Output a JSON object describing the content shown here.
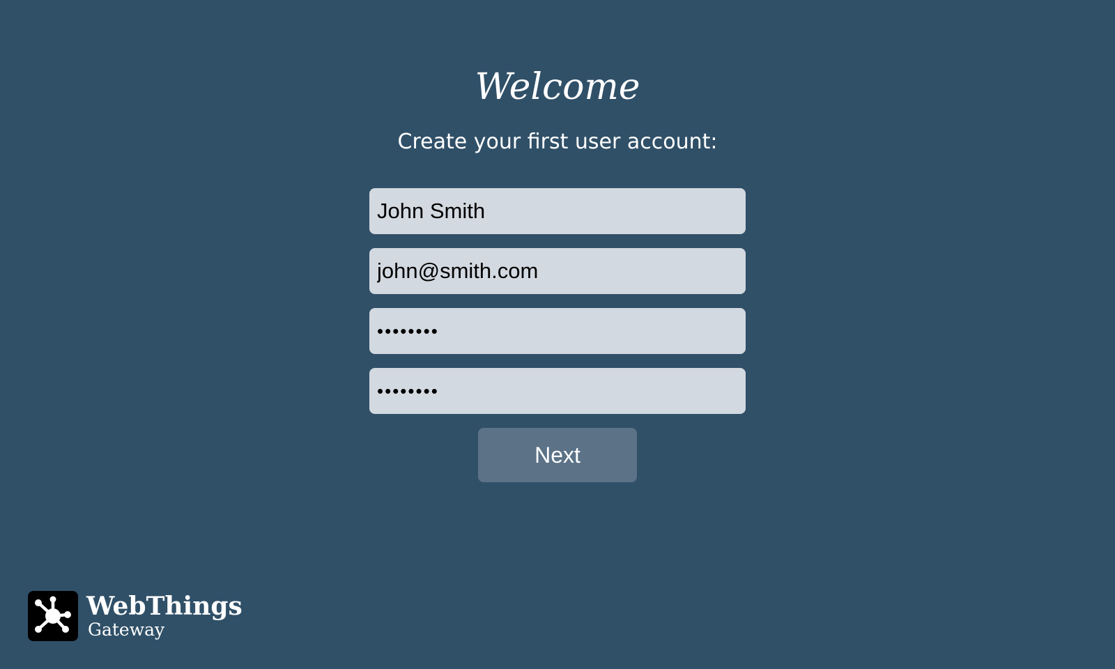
{
  "page": {
    "title": "Welcome",
    "subtitle": "Create your first user account:"
  },
  "form": {
    "name_value": "John Smith",
    "email_value": "john@smith.com",
    "password_value": "password",
    "confirm_password_value": "password",
    "next_label": "Next"
  },
  "branding": {
    "brand": "WebThings",
    "product": "Gateway",
    "logo_icon": "webthings-logo-icon"
  },
  "colors": {
    "background": "#305068",
    "field_background": "#d3d9e0",
    "button_background": "#5b7287",
    "text": "#ffffff"
  }
}
